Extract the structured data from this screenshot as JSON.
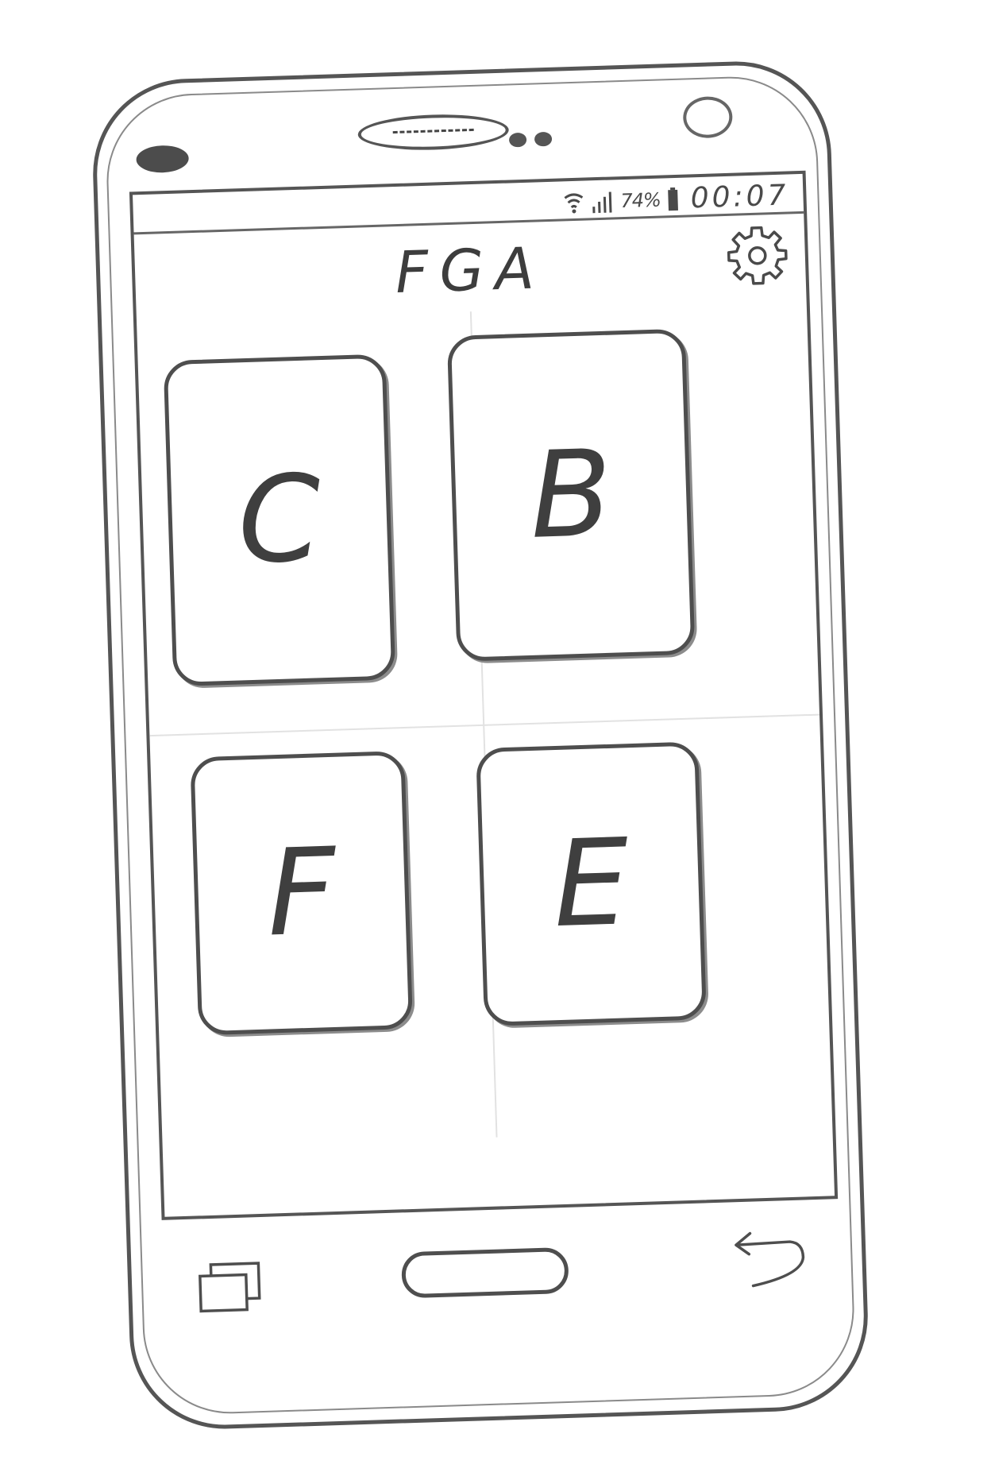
{
  "status_bar": {
    "battery_percent": "74%",
    "time": "00:07"
  },
  "header": {
    "title": "FGA",
    "settings_icon": "gear-icon"
  },
  "tiles": [
    {
      "label": "C"
    },
    {
      "label": "B"
    },
    {
      "label": "F"
    },
    {
      "label": "E"
    }
  ],
  "nav_bar": {
    "recents_icon": "recents-icon",
    "home_icon": "home-button",
    "back_icon": "back-arrow-icon"
  }
}
